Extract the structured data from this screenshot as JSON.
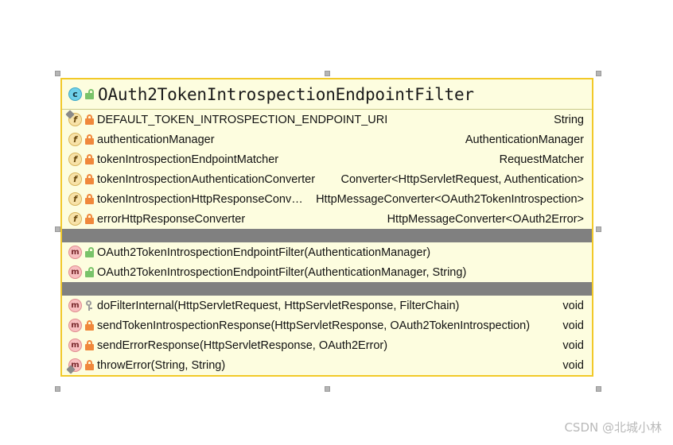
{
  "diagram": {
    "type": "uml-class-diagram",
    "selected": true,
    "colors": {
      "box_background": "#fdfddf",
      "box_border": "#f2c928",
      "separator_bar": "#808080",
      "handle": "#b5b5b5",
      "text": "#111111",
      "watermark": "#b9b9b9"
    },
    "class": {
      "name": "OAuth2TokenIntrospectionEndpointFilter",
      "icon": "class-icon",
      "visibility_icon": "public-unlocked-icon",
      "fields": [
        {
          "icon": "field-icon",
          "static": true,
          "visibility_icon": "private-lock-icon",
          "name": "DEFAULT_TOKEN_INTROSPECTION_ENDPOINT_URI",
          "type": "String"
        },
        {
          "icon": "field-icon",
          "static": false,
          "visibility_icon": "private-lock-icon",
          "name": "authenticationManager",
          "type": "AuthenticationManager"
        },
        {
          "icon": "field-icon",
          "static": false,
          "visibility_icon": "private-lock-icon",
          "name": "tokenIntrospectionEndpointMatcher",
          "type": "RequestMatcher"
        },
        {
          "icon": "field-icon",
          "static": false,
          "visibility_icon": "private-lock-icon",
          "name": "tokenIntrospectionAuthenticationConverter",
          "type": "Converter<HttpServletRequest, Authentication>"
        },
        {
          "icon": "field-icon",
          "static": false,
          "visibility_icon": "private-lock-icon",
          "name": "tokenIntrospectionHttpResponseConverter",
          "type": "HttpMessageConverter<OAuth2TokenIntrospection>"
        },
        {
          "icon": "field-icon",
          "static": false,
          "visibility_icon": "private-lock-icon",
          "name": "errorHttpResponseConverter",
          "type": "HttpMessageConverter<OAuth2Error>"
        }
      ],
      "constructors": [
        {
          "icon": "method-icon",
          "visibility_icon": "public-unlocked-icon",
          "name": "OAuth2TokenIntrospectionEndpointFilter(AuthenticationManager)",
          "type": ""
        },
        {
          "icon": "method-icon",
          "visibility_icon": "public-unlocked-icon",
          "name": "OAuth2TokenIntrospectionEndpointFilter(AuthenticationManager, String)",
          "type": ""
        }
      ],
      "methods": [
        {
          "icon": "method-icon",
          "visibility_icon": "protected-key-icon",
          "name": "doFilterInternal(HttpServletRequest, HttpServletResponse, FilterChain)",
          "type": "void"
        },
        {
          "icon": "method-icon",
          "visibility_icon": "private-lock-icon",
          "name": "sendTokenIntrospectionResponse(HttpServletResponse, OAuth2TokenIntrospection)",
          "type": "void"
        },
        {
          "icon": "method-icon",
          "visibility_icon": "private-lock-icon",
          "name": "sendErrorResponse(HttpServletResponse, OAuth2Error)",
          "type": "void"
        },
        {
          "icon": "method-icon",
          "visibility_icon": "private-lock-icon",
          "name": "throwError(String, String)",
          "type": "void"
        }
      ]
    }
  },
  "watermark": {
    "text": "CSDN @北城小林"
  }
}
